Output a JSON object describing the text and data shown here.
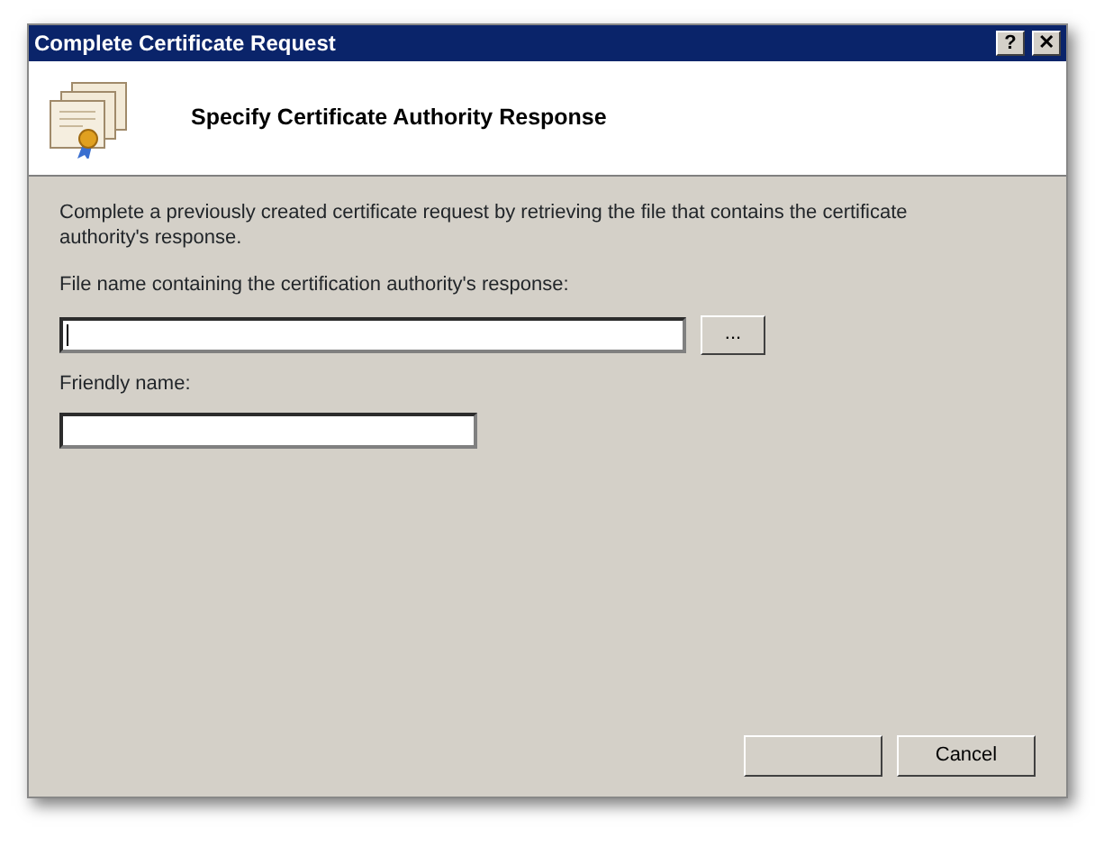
{
  "window": {
    "title": "Complete Certificate Request",
    "title_buttons": [
      {
        "label": "?"
      },
      {
        "label": "✕"
      }
    ]
  },
  "header": {
    "title": "Specify Certificate Authority Response"
  },
  "description": "Complete a previously created certificate request by retrieving the file that contains the certificate authority's response.",
  "fields": [
    {
      "label": "File name containing the certification authority's response:",
      "kind": "file",
      "browse": "...",
      "focused": true
    },
    {
      "label": "Friendly name:",
      "kind": "text",
      "focused": false
    }
  ],
  "buttons": [
    {
      "kind": "blank"
    },
    {
      "kind": "text",
      "label": "Cancel"
    }
  ]
}
